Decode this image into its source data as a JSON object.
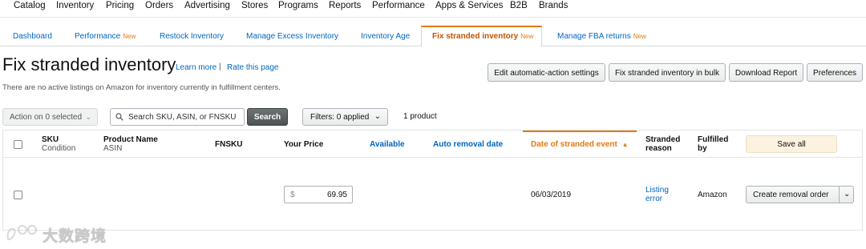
{
  "topnav": [
    "Catalog",
    "Inventory",
    "Pricing",
    "Orders",
    "Advertising",
    "Stores",
    "Programs",
    "Reports",
    "Performance",
    "Apps & Services",
    "B2B",
    "Brands"
  ],
  "tabs": [
    {
      "label": "Dashboard",
      "badge": ""
    },
    {
      "label": "Performance",
      "badge": "New"
    },
    {
      "label": "Restock Inventory",
      "badge": ""
    },
    {
      "label": "Manage Excess Inventory",
      "badge": ""
    },
    {
      "label": "Inventory Age",
      "badge": ""
    },
    {
      "label": "Fix stranded inventory",
      "badge": "New"
    },
    {
      "label": "Manage FBA returns",
      "badge": "New"
    }
  ],
  "page": {
    "title": "Fix stranded inventory",
    "learn_more": "Learn more",
    "separator": "|",
    "rate_page": "Rate this page",
    "info": "There are no active listings on Amazon for inventory currently in fulfillment centers."
  },
  "actions": {
    "edit_settings": "Edit automatic-action settings",
    "fix_bulk": "Fix stranded inventory in bulk",
    "download": "Download Report",
    "preferences": "Preferences"
  },
  "toolbar": {
    "action_select": "Action on 0 selected",
    "search_placeholder": "Search SKU, ASIN, or FNSKU",
    "search_button": "Search",
    "filters": "Filters: 0 applied",
    "count": "1 product"
  },
  "table": {
    "headers": {
      "sku": "SKU",
      "sku_sub": "Condition",
      "product": "Product Name",
      "product_sub": "ASIN",
      "fnsku": "FNSKU",
      "price": "Your Price",
      "available": "Available",
      "auto_removal": "Auto removal date",
      "date_event": "Date of stranded event",
      "stranded_1": "Stranded",
      "stranded_2": "reason",
      "fulfilled_1": "Fulfilled",
      "fulfilled_2": "by",
      "save_all": "Save all"
    },
    "rows": [
      {
        "currency": "$",
        "price": "69.95",
        "date": "06/03/2019",
        "reason_1": "Listing",
        "reason_2": "error",
        "fulfilled": "Amazon",
        "action": "Create removal order"
      }
    ]
  },
  "watermark": "大数跨境",
  "colors": {
    "accent": "#e47911",
    "link": "#0066c0"
  }
}
